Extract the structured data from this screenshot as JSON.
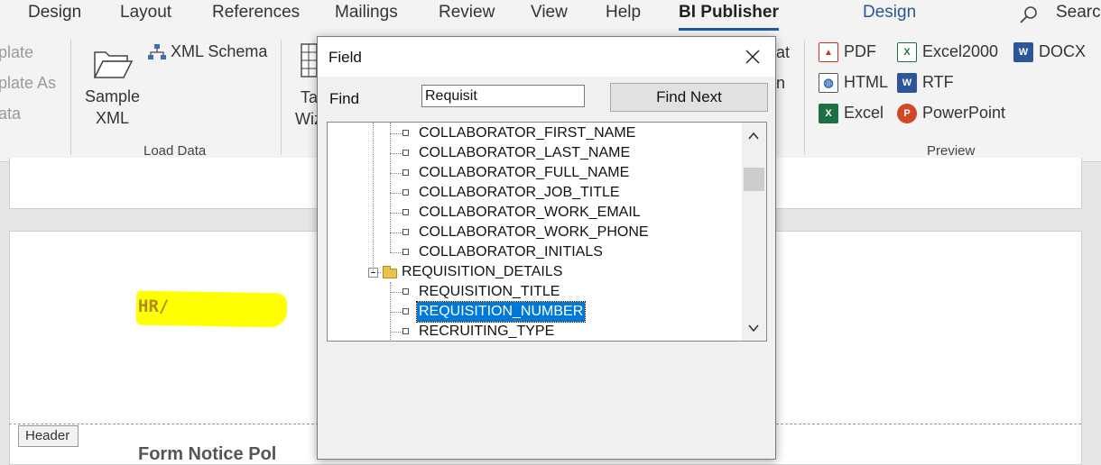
{
  "tabs": [
    "Design",
    "Layout",
    "References",
    "Mailings",
    "Review",
    "View",
    "Help",
    "BI Publisher"
  ],
  "active_tab": "BI Publisher",
  "context_tab": "Design",
  "search": {
    "label": "Search"
  },
  "ribbon": {
    "left_partial": [
      "plate",
      "plate As",
      "ata"
    ],
    "sample_xml": [
      "Sample",
      "XML"
    ],
    "xml_schema": "XML Schema",
    "load_data_group": "Load Data",
    "table_wizard_partial": [
      "Ta",
      "Wiz"
    ],
    "hidden_partial": [
      "at",
      "n"
    ],
    "preview": {
      "pdf": "PDF",
      "html": "HTML",
      "excel": "Excel",
      "excel2000": "Excel2000",
      "rtf": "RTF",
      "powerpoint": "PowerPoint",
      "docx": "DOCX",
      "group_label": "Preview"
    }
  },
  "document": {
    "hr_text": "HR/",
    "header_label": "Header",
    "cutoff_text": "Form Notice Pol"
  },
  "dialog": {
    "title": "Field",
    "find_label": "Find",
    "find_value": "Requisit",
    "find_next": "Find Next",
    "tree": [
      {
        "label": "COLLABORATOR_FIRST_NAME",
        "level": 2,
        "type": "leaf"
      },
      {
        "label": "COLLABORATOR_LAST_NAME",
        "level": 2,
        "type": "leaf"
      },
      {
        "label": "COLLABORATOR_FULL_NAME",
        "level": 2,
        "type": "leaf"
      },
      {
        "label": "COLLABORATOR_JOB_TITLE",
        "level": 2,
        "type": "leaf"
      },
      {
        "label": "COLLABORATOR_WORK_EMAIL",
        "level": 2,
        "type": "leaf"
      },
      {
        "label": "COLLABORATOR_WORK_PHONE",
        "level": 2,
        "type": "leaf"
      },
      {
        "label": "COLLABORATOR_INITIALS",
        "level": 2,
        "type": "leaf"
      },
      {
        "label": "REQUISITION_DETAILS",
        "level": 1,
        "type": "folder"
      },
      {
        "label": "REQUISITION_TITLE",
        "level": 2,
        "type": "leaf"
      },
      {
        "label": "REQUISITION_NUMBER",
        "level": 2,
        "type": "leaf",
        "selected": true
      },
      {
        "label": "RECRUITING_TYPE",
        "level": 2,
        "type": "leaf"
      }
    ]
  },
  "colors": {
    "accent": "#1e5aa8",
    "selection": "#0078d7",
    "highlight": "#ffff00"
  }
}
